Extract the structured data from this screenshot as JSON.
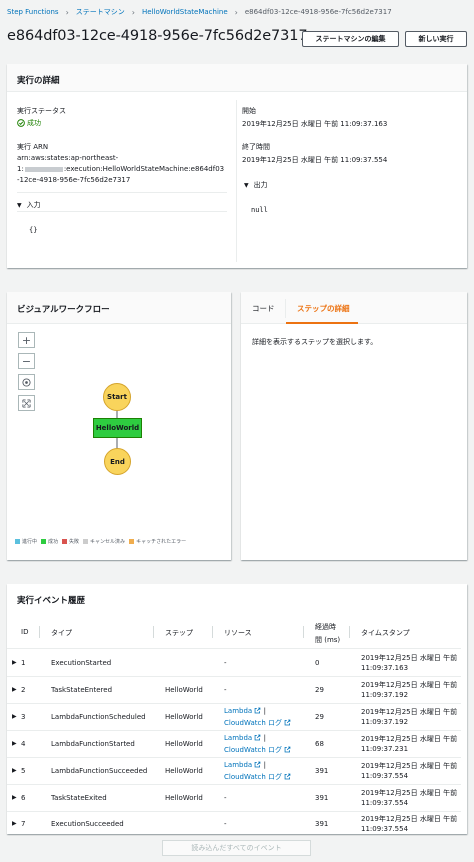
{
  "breadcrumb": {
    "items": [
      "Step Functions",
      "ステートマシン",
      "HelloWorldStateMachine"
    ],
    "current": "e864df03-12ce-4918-956e-7fc56d2e7317"
  },
  "header": {
    "title": "e864df03-12ce-4918-956e-7fc56d2e7317",
    "edit_button": "ステートマシンの編集",
    "new_execution_button": "新しい実行"
  },
  "execution_details": {
    "title": "実行の詳細",
    "status_label": "実行ステータス",
    "status_value": "成功",
    "arn_label": "実行 ARN",
    "arn_line1": "arn:aws:states:ap-northeast-",
    "arn_line2_prefix": "1:",
    "arn_line2_suffix": ":execution:HelloWorldStateMachine:e864df03",
    "arn_line3": "-12ce-4918-956e-7fc56d2e7317",
    "input_label": "入力",
    "input_value": "{}",
    "start_label": "開始",
    "start_value": "2019年12月25日 水曜日 午前 11:09:37.163",
    "end_label": "終了時間",
    "end_value": "2019年12月25日 水曜日 午前 11:09:37.554",
    "output_label": "出力",
    "output_value": "null"
  },
  "workflow": {
    "title": "ビジュアルワークフロー",
    "zoom_in": "+",
    "zoom_out": "−",
    "nodes": {
      "start": "Start",
      "task": "HelloWorld",
      "end": "End"
    },
    "legend": [
      {
        "label": "進行中",
        "color": "#5bc0de"
      },
      {
        "label": "成功",
        "color": "#2ecc40"
      },
      {
        "label": "失敗",
        "color": "#d9534f"
      },
      {
        "label": "キャンセル済み",
        "color": "#cccccc"
      },
      {
        "label": "キャッチされたエラー",
        "color": "#f0ad4e"
      }
    ]
  },
  "step_panel": {
    "tabs": [
      "コード",
      "ステップの詳細"
    ],
    "active_tab": 1,
    "message": "詳細を表示するステップを選択します。"
  },
  "history": {
    "title": "実行イベント履歴",
    "columns": {
      "id": "ID",
      "type": "タイプ",
      "step": "ステップ",
      "resource": "リソース",
      "elapsed_line1": "経過時",
      "elapsed_line2": "間 (ms)",
      "timestamp": "タイムスタンプ"
    },
    "lambda_link": "Lambda",
    "cloudwatch_link": "CloudWatch ログ",
    "link_sep": " |",
    "dash": "-",
    "rows": [
      {
        "id": "1",
        "type": "ExecutionStarted",
        "step": "",
        "resource": "-",
        "elapsed": "0",
        "ts1": "2019年12月25日 水曜日 午前",
        "ts2": "11:09:37.163"
      },
      {
        "id": "2",
        "type": "TaskStateEntered",
        "step": "HelloWorld",
        "resource": "-",
        "elapsed": "29",
        "ts1": "2019年12月25日 水曜日 午前",
        "ts2": "11:09:37.192"
      },
      {
        "id": "3",
        "type": "LambdaFunctionScheduled",
        "step": "HelloWorld",
        "resource": "links",
        "elapsed": "29",
        "ts1": "2019年12月25日 水曜日 午前",
        "ts2": "11:09:37.192"
      },
      {
        "id": "4",
        "type": "LambdaFunctionStarted",
        "step": "HelloWorld",
        "resource": "links",
        "elapsed": "68",
        "ts1": "2019年12月25日 水曜日 午前",
        "ts2": "11:09:37.231"
      },
      {
        "id": "5",
        "type": "LambdaFunctionSucceeded",
        "step": "HelloWorld",
        "resource": "links",
        "elapsed": "391",
        "ts1": "2019年12月25日 水曜日 午前",
        "ts2": "11:09:37.554"
      },
      {
        "id": "6",
        "type": "TaskStateExited",
        "step": "HelloWorld",
        "resource": "-",
        "elapsed": "391",
        "ts1": "2019年12月25日 水曜日 午前",
        "ts2": "11:09:37.554"
      },
      {
        "id": "7",
        "type": "ExecutionSucceeded",
        "step": "",
        "resource": "-",
        "elapsed": "391",
        "ts1": "2019年12月25日 水曜日 午前",
        "ts2": "11:09:37.554"
      }
    ],
    "load_all": "読み込んだすべてのイベント"
  }
}
